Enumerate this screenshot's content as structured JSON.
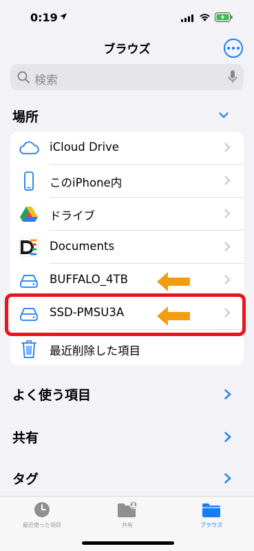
{
  "status_bar": {
    "time": "0:19"
  },
  "header": {
    "title": "ブラウズ"
  },
  "search": {
    "placeholder": "検索"
  },
  "locations": {
    "title": "場所",
    "items": [
      {
        "label": "iCloud Drive",
        "icon": "icloud-icon"
      },
      {
        "label": "このiPhone内",
        "icon": "iphone-icon"
      },
      {
        "label": "ドライブ",
        "icon": "google-drive-icon"
      },
      {
        "label": "Documents",
        "icon": "documents-app-icon"
      },
      {
        "label": "BUFFALO_4TB",
        "icon": "external-drive-icon"
      },
      {
        "label": "SSD-PMSU3A",
        "icon": "external-drive-icon"
      },
      {
        "label": "最近削除した項目",
        "icon": "trash-icon"
      }
    ]
  },
  "sections": {
    "favorites": "よく使う項目",
    "shared": "共有",
    "tags": "タグ"
  },
  "tab_bar": {
    "recents": "最近使った項目",
    "shared": "共有",
    "browse": "ブラウズ"
  },
  "colors": {
    "accent": "#1a7cf5",
    "highlight": "#e8151b",
    "arrow": "#f39c12"
  }
}
